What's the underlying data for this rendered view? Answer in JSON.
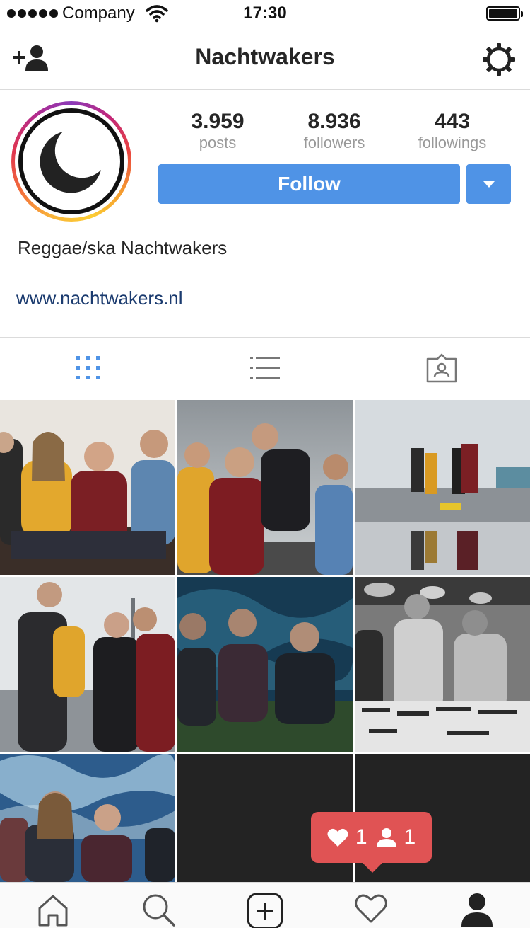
{
  "status_bar": {
    "carrier": "Company",
    "time": "17:30",
    "icons": [
      "signal-dots-icon",
      "wifi-icon",
      "battery-icon"
    ]
  },
  "nav": {
    "title": "Nachtwakers",
    "left_icon": "add-user-icon",
    "right_icon": "gear-icon"
  },
  "profile": {
    "avatar_icon": "crescent-moon-icon",
    "stats": [
      {
        "value": "3.959",
        "label": "posts"
      },
      {
        "value": "8.936",
        "label": "followers"
      },
      {
        "value": "443",
        "label": "followings"
      }
    ],
    "follow_label": "Follow",
    "bio": "Reggae/ska Nachtwakers",
    "website": "www.nachtwakers.nl"
  },
  "view_tabs": [
    {
      "icon": "grid-icon",
      "active": true
    },
    {
      "icon": "list-icon",
      "active": false
    },
    {
      "icon": "tagged-photos-icon",
      "active": false
    }
  ],
  "posts": [
    {
      "description": "band photo"
    },
    {
      "description": "band photo"
    },
    {
      "description": "band photo"
    },
    {
      "description": "band photo"
    },
    {
      "description": "band photo"
    },
    {
      "description": "band photo"
    },
    {
      "description": "band photo"
    },
    {
      "description": "empty"
    },
    {
      "description": "empty"
    }
  ],
  "notification": {
    "likes": "1",
    "follows": "1"
  },
  "tab_bar": [
    "home-icon",
    "search-icon",
    "add-post-icon",
    "activity-heart-icon",
    "profile-icon"
  ],
  "colors": {
    "accent": "#4f93e6",
    "notification": "#e05354",
    "link": "#1b3b6f",
    "muted": "#999999"
  }
}
